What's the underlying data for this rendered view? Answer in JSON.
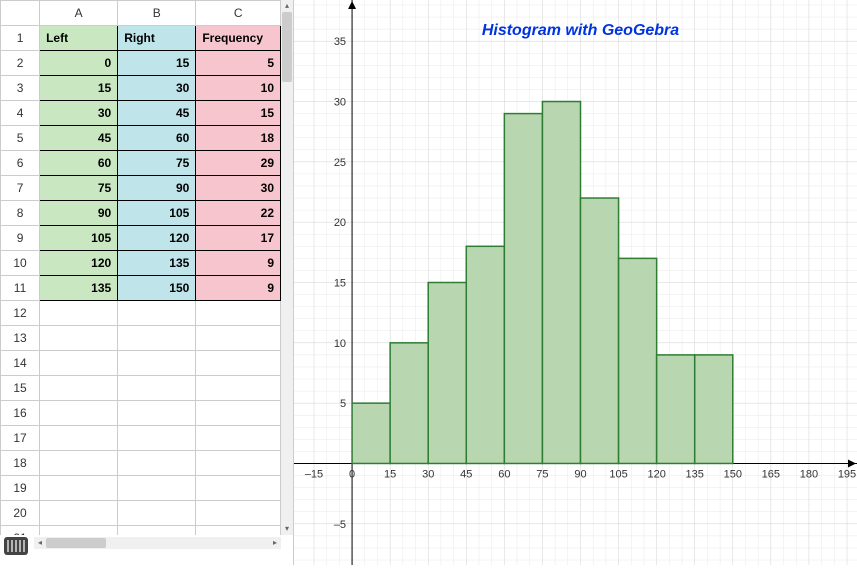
{
  "spreadsheet": {
    "columns": [
      "A",
      "B",
      "C"
    ],
    "visible_rows": 21,
    "headers": {
      "A": "Left",
      "B": "Right",
      "C": "Frequency"
    },
    "rows": [
      {
        "A": 0,
        "B": 15,
        "C": 5
      },
      {
        "A": 15,
        "B": 30,
        "C": 10
      },
      {
        "A": 30,
        "B": 45,
        "C": 15
      },
      {
        "A": 45,
        "B": 60,
        "C": 18
      },
      {
        "A": 60,
        "B": 75,
        "C": 29
      },
      {
        "A": 75,
        "B": 90,
        "C": 30
      },
      {
        "A": 90,
        "B": 105,
        "C": 22
      },
      {
        "A": 105,
        "B": 120,
        "C": 17
      },
      {
        "A": 120,
        "B": 135,
        "C": 9
      },
      {
        "A": 135,
        "B": 150,
        "C": 9
      }
    ]
  },
  "chart_data": {
    "type": "bar",
    "title": "Histogram with GeoGebra",
    "xlabel": "",
    "ylabel": "",
    "xlim": [
      -15,
      195
    ],
    "ylim": [
      -8,
      38
    ],
    "x_ticks": [
      -15,
      0,
      15,
      30,
      45,
      60,
      75,
      90,
      105,
      120,
      135,
      150,
      165,
      180,
      195
    ],
    "y_ticks": [
      -5,
      5,
      10,
      15,
      20,
      25,
      30,
      35
    ],
    "bins": [
      {
        "left": 0,
        "right": 15,
        "freq": 5
      },
      {
        "left": 15,
        "right": 30,
        "freq": 10
      },
      {
        "left": 30,
        "right": 45,
        "freq": 15
      },
      {
        "left": 45,
        "right": 60,
        "freq": 18
      },
      {
        "left": 60,
        "right": 75,
        "freq": 29
      },
      {
        "left": 75,
        "right": 90,
        "freq": 30
      },
      {
        "left": 90,
        "right": 105,
        "freq": 22
      },
      {
        "left": 105,
        "right": 120,
        "freq": 17
      },
      {
        "left": 120,
        "right": 135,
        "freq": 9
      },
      {
        "left": 135,
        "right": 150,
        "freq": 9
      }
    ],
    "grid": true
  }
}
